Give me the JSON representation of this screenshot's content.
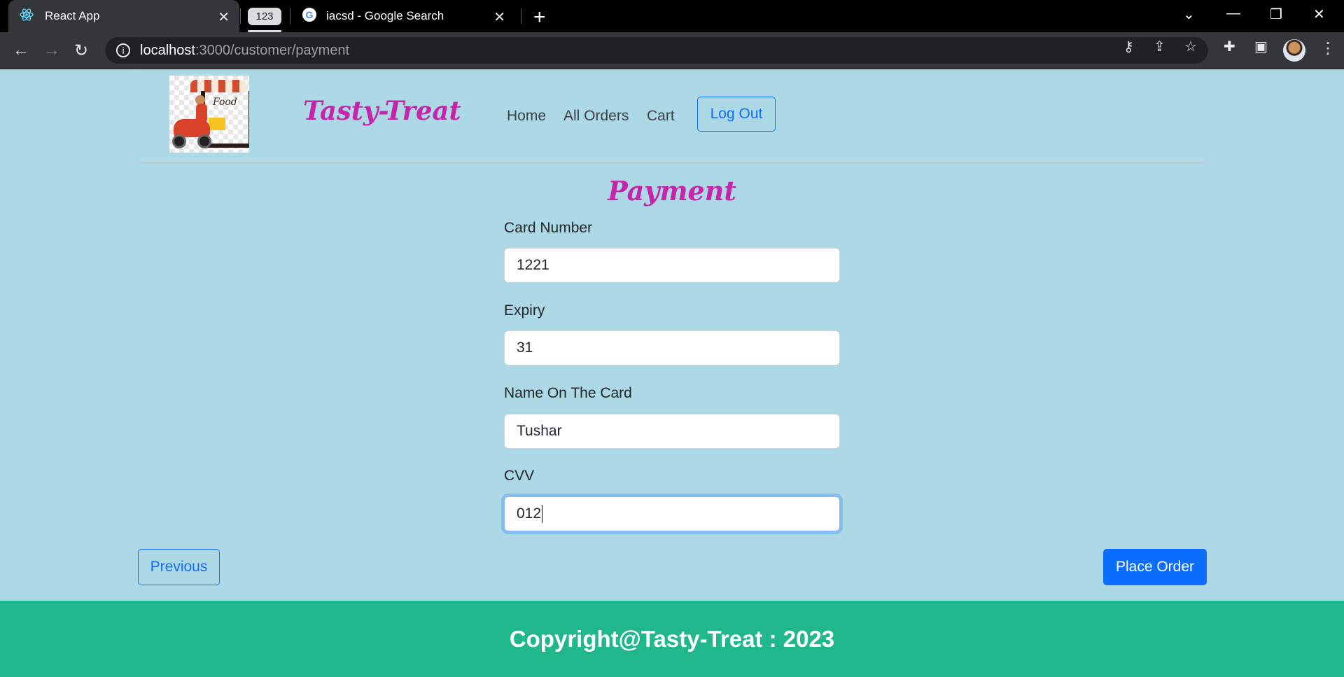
{
  "browser": {
    "tabs": [
      {
        "title": "React App",
        "icon": "react-icon",
        "active": true
      },
      {
        "title": "iacsd - Google Search",
        "icon": "google-icon",
        "active": false
      }
    ],
    "tab_group_label": "123",
    "url_host": "localhost",
    "url_path": ":3000/customer/payment"
  },
  "header": {
    "brand": "Tasty-Treat",
    "logo_text": "Food",
    "nav": [
      "Home",
      "All Orders",
      "Cart"
    ],
    "logout_label": "Log Out"
  },
  "payment": {
    "title": "Payment",
    "fields": [
      {
        "label": "Card Number",
        "value": "1221"
      },
      {
        "label": "Expiry",
        "value": "31"
      },
      {
        "label": "Name On The Card",
        "value": "Tushar"
      },
      {
        "label": "CVV",
        "value": "012"
      }
    ]
  },
  "actions": {
    "previous_label": "Previous",
    "place_order_label": "Place Order"
  },
  "footer": {
    "text": "Copyright@Tasty-Treat : 2023"
  },
  "colors": {
    "page_bg": "#add8e6",
    "brand": "#c624a9",
    "primary": "#0d6efd",
    "footer_bg": "#20b78c"
  }
}
